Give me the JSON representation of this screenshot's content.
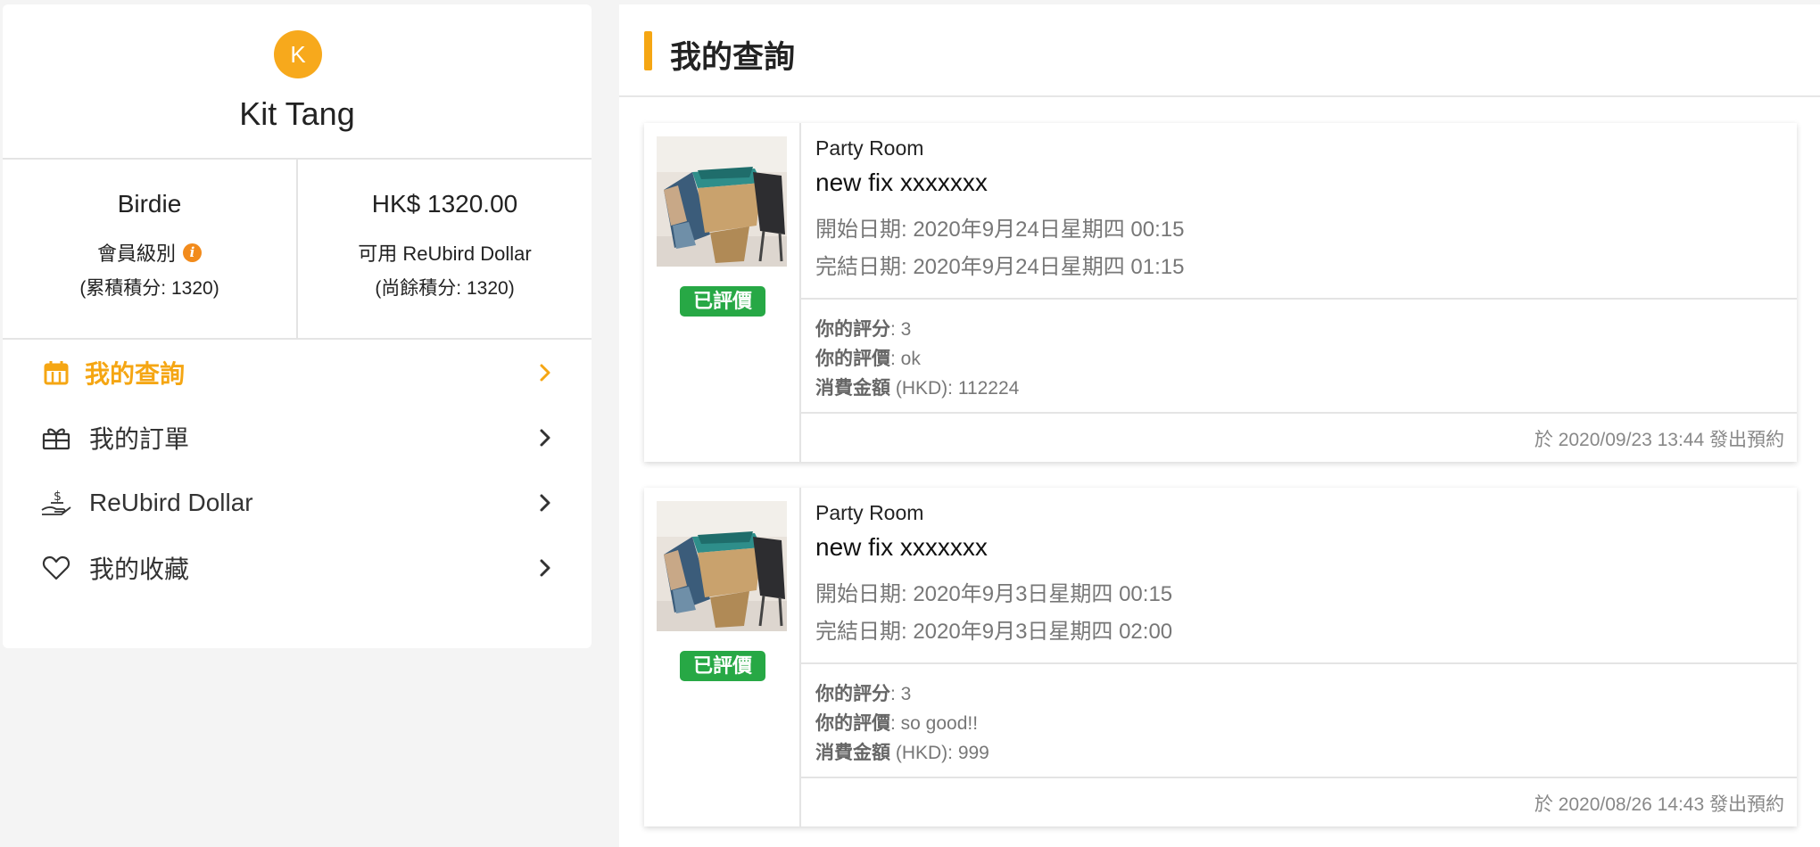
{
  "profile": {
    "avatar_letter": "K",
    "name": "Kit Tang"
  },
  "stats": {
    "tier": {
      "title": "Birdie",
      "label": "會員級別",
      "info_icon": "i",
      "sub": "(累積積分: 1320)"
    },
    "dollar": {
      "title": "HK$ 1320.00",
      "label": "可用 ReUbird Dollar",
      "sub": "(尚餘積分: 1320)"
    }
  },
  "menu": [
    {
      "label": "我的查詢",
      "icon": "calendar-icon",
      "active": true
    },
    {
      "label": "我的訂單",
      "icon": "gift-box-icon",
      "active": false
    },
    {
      "label": "ReUbird Dollar",
      "icon": "hand-money-icon",
      "active": false
    },
    {
      "label": "我的收藏",
      "icon": "heart-icon",
      "active": false
    }
  ],
  "main": {
    "title": "我的查詢",
    "accent_color": "#f5a613",
    "cards": [
      {
        "badge": "已評價",
        "room_type": "Party Room",
        "room_name": "new fix xxxxxxx",
        "start": "開始日期: 2020年9月24日星期四 00:15",
        "end": "完結日期: 2020年9月24日星期四 01:15",
        "score_label": "你的評分",
        "score_value": ": 3",
        "review_label": "你的評價",
        "review_value": ": ok",
        "amount_label": "消費金額",
        "amount_value": " (HKD): 112224",
        "booked": "於 2020/09/23 13:44 發出預約"
      },
      {
        "badge": "已評價",
        "room_type": "Party Room",
        "room_name": "new fix xxxxxxx",
        "start": "開始日期: 2020年9月3日星期四 00:15",
        "end": "完結日期: 2020年9月3日星期四 02:00",
        "score_label": "你的評分",
        "score_value": ": 3",
        "review_label": "你的評價",
        "review_value": ": so good!!",
        "amount_label": "消費金額",
        "amount_value": " (HKD): 999",
        "booked": "於 2020/08/26 14:43 發出預約"
      }
    ]
  },
  "colors": {
    "accent": "#f5a613",
    "badge_green": "#27a845",
    "avatar": "#f7a91c",
    "info": "#f28b1c"
  }
}
